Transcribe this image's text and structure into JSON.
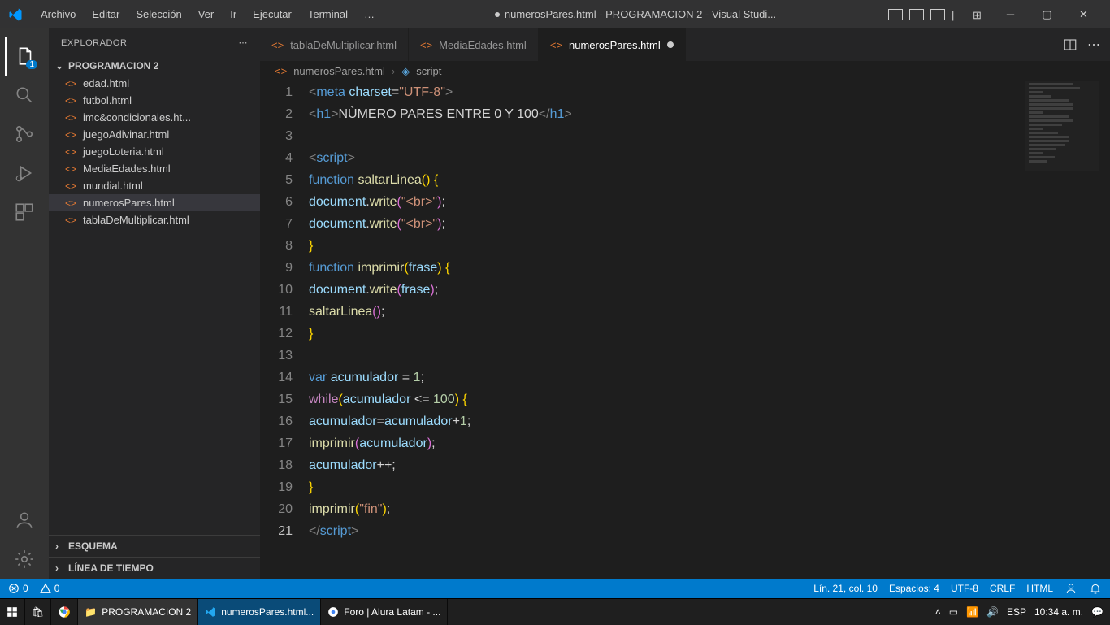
{
  "titlebar": {
    "menus": [
      "Archivo",
      "Editar",
      "Selección",
      "Ver",
      "Ir",
      "Ejecutar",
      "Terminal",
      "…"
    ],
    "title": "numerosPares.html - PROGRAMACION 2 - Visual Studi..."
  },
  "sidebar": {
    "header": "EXPLORADOR",
    "root": "PROGRAMACION 2",
    "files": [
      "edad.html",
      "futbol.html",
      "imc&condicionales.ht...",
      "juegoAdivinar.html",
      "juegoLoteria.html",
      "MediaEdades.html",
      "mundial.html",
      "numerosPares.html",
      "tablaDeMultiplicar.html"
    ],
    "activeFile": "numerosPares.html",
    "outline": "ESQUEMA",
    "timeline": "LÍNEA DE TIEMPO"
  },
  "tabs": [
    {
      "label": "tablaDeMultiplicar.html",
      "active": false,
      "modified": false
    },
    {
      "label": "MediaEdades.html",
      "active": false,
      "modified": false
    },
    {
      "label": "numerosPares.html",
      "active": true,
      "modified": true
    }
  ],
  "breadcrumb": {
    "file": "numerosPares.html",
    "symbol": "script"
  },
  "code": {
    "lines": [
      [
        [
          "tag",
          "<"
        ],
        [
          "el",
          "meta"
        ],
        [
          "text",
          " "
        ],
        [
          "attr",
          "charset"
        ],
        [
          "op",
          "="
        ],
        [
          "str",
          "\"UTF-8\""
        ],
        [
          "tag",
          ">"
        ]
      ],
      [
        [
          "tag",
          "<"
        ],
        [
          "el",
          "h1"
        ],
        [
          "tag",
          ">"
        ],
        [
          "text",
          "NÙMERO PARES ENTRE 0 Y 100"
        ],
        [
          "tag",
          "</"
        ],
        [
          "el",
          "h1"
        ],
        [
          "tag",
          ">"
        ]
      ],
      [],
      [
        [
          "tag",
          "<"
        ],
        [
          "el",
          "script"
        ],
        [
          "tag",
          ">"
        ]
      ],
      [
        [
          "indent",
          1
        ],
        [
          "kw",
          "function"
        ],
        [
          "text",
          " "
        ],
        [
          "fn",
          "saltarLinea"
        ],
        [
          "brace-y",
          "()"
        ],
        [
          "text",
          " "
        ],
        [
          "brace-y",
          "{"
        ]
      ],
      [
        [
          "indent",
          2
        ],
        [
          "var",
          "document"
        ],
        [
          "op",
          "."
        ],
        [
          "fn",
          "write"
        ],
        [
          "brace-p",
          "("
        ],
        [
          "str",
          "\"<br>\""
        ],
        [
          "brace-p",
          ")"
        ],
        [
          "op",
          ";"
        ]
      ],
      [
        [
          "indent",
          2
        ],
        [
          "var",
          "document"
        ],
        [
          "op",
          "."
        ],
        [
          "fn",
          "write"
        ],
        [
          "brace-p",
          "("
        ],
        [
          "str",
          "\"<br>\""
        ],
        [
          "brace-p",
          ")"
        ],
        [
          "op",
          ";"
        ]
      ],
      [
        [
          "indent",
          1
        ],
        [
          "brace-y",
          "}"
        ]
      ],
      [
        [
          "indent",
          1
        ],
        [
          "kw",
          "function"
        ],
        [
          "text",
          " "
        ],
        [
          "fn",
          "imprimir"
        ],
        [
          "brace-y",
          "("
        ],
        [
          "var",
          "frase"
        ],
        [
          "brace-y",
          ")"
        ],
        [
          "text",
          " "
        ],
        [
          "brace-y",
          "{"
        ]
      ],
      [
        [
          "indent",
          2
        ],
        [
          "var",
          "document"
        ],
        [
          "op",
          "."
        ],
        [
          "fn",
          "write"
        ],
        [
          "brace-p",
          "("
        ],
        [
          "var",
          "frase"
        ],
        [
          "brace-p",
          ")"
        ],
        [
          "op",
          ";"
        ]
      ],
      [
        [
          "indent",
          2
        ],
        [
          "fn",
          "saltarLinea"
        ],
        [
          "brace-p",
          "()"
        ],
        [
          "op",
          ";"
        ]
      ],
      [
        [
          "indent",
          1
        ],
        [
          "brace-y",
          "}"
        ]
      ],
      [],
      [
        [
          "indent",
          1
        ],
        [
          "kw",
          "var"
        ],
        [
          "text",
          " "
        ],
        [
          "var",
          "acumulador"
        ],
        [
          "text",
          " "
        ],
        [
          "op",
          "="
        ],
        [
          "text",
          " "
        ],
        [
          "num",
          "1"
        ],
        [
          "op",
          ";"
        ]
      ],
      [
        [
          "indent",
          1
        ],
        [
          "kw2",
          "while"
        ],
        [
          "brace-y",
          "("
        ],
        [
          "var",
          "acumulador"
        ],
        [
          "text",
          " "
        ],
        [
          "op",
          "<="
        ],
        [
          "text",
          " "
        ],
        [
          "num",
          "100"
        ],
        [
          "brace-y",
          ")"
        ],
        [
          "text",
          " "
        ],
        [
          "brace-y",
          "{"
        ]
      ],
      [
        [
          "indent",
          2
        ],
        [
          "var",
          "acumulador"
        ],
        [
          "op",
          "="
        ],
        [
          "var",
          "acumulador"
        ],
        [
          "op",
          "+"
        ],
        [
          "num",
          "1"
        ],
        [
          "op",
          ";"
        ]
      ],
      [
        [
          "indent",
          2
        ],
        [
          "fn",
          "imprimir"
        ],
        [
          "brace-p",
          "("
        ],
        [
          "var",
          "acumulador"
        ],
        [
          "brace-p",
          ")"
        ],
        [
          "op",
          ";"
        ]
      ],
      [
        [
          "indent",
          2
        ],
        [
          "var",
          "acumulador"
        ],
        [
          "op",
          "++;"
        ]
      ],
      [
        [
          "indent",
          1
        ],
        [
          "brace-y",
          "}"
        ]
      ],
      [
        [
          "indent",
          1
        ],
        [
          "fn",
          "imprimir"
        ],
        [
          "brace-y",
          "("
        ],
        [
          "str",
          "\"fin\""
        ],
        [
          "brace-y",
          ")"
        ],
        [
          "op",
          ";"
        ]
      ],
      [
        [
          "tag",
          "</"
        ],
        [
          "el",
          "script"
        ],
        [
          "tag",
          ">"
        ]
      ]
    ],
    "currentLine": 21
  },
  "statusbar": {
    "errors": "0",
    "warnings": "0",
    "position": "Lín. 21, col. 10",
    "spaces": "Espacios: 4",
    "encoding": "UTF-8",
    "eol": "CRLF",
    "language": "HTML"
  },
  "taskbar": {
    "folder": "PROGRAMACION 2",
    "vscode": "numerosPares.html...",
    "chrome": "Foro | Alura Latam - ...",
    "lang": "ESP",
    "time": "10:34 a. m."
  },
  "activitybar": {
    "badge": "1"
  }
}
